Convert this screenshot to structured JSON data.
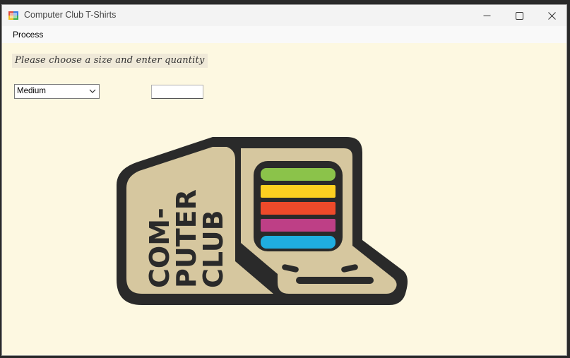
{
  "window": {
    "title": "Computer Club T-Shirts"
  },
  "menu": {
    "items": [
      {
        "label": "Process"
      }
    ]
  },
  "form": {
    "prompt": "Please choose a size and enter quantity",
    "size_selected": "Medium",
    "quantity_value": ""
  },
  "logo": {
    "line1": "COM-",
    "line2": "PUTER",
    "line3": "CLUB",
    "stripe_colors": [
      "#8bc34a",
      "#fdd020",
      "#ee4a2a",
      "#be3f86",
      "#1faee0"
    ]
  },
  "colors": {
    "background": "#fdf8e1",
    "logo_fill": "#d6c79f",
    "logo_outline": "#2a2a2a"
  }
}
